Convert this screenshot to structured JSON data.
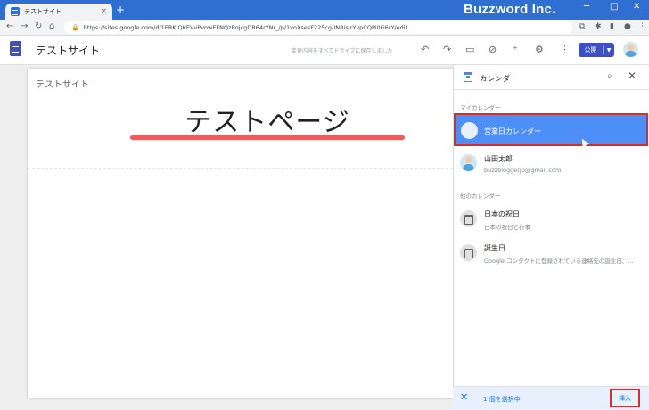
{
  "browser": {
    "tab_title": "テストサイト",
    "tab_close": "×",
    "new_tab": "+",
    "brand": "Buzzword Inc.",
    "url": "https://sites.google.com/d/1ERKlQKEVvPvowEFNQzRojcgDR64rYNr_/p/1voXsesF225cg-INRislrYvpCQPi0G6rY/edit",
    "nav": {
      "back": "←",
      "forward": "→",
      "reload": "↻",
      "home": "⌂"
    },
    "window_controls": {
      "minimize": "─",
      "maximize": "□",
      "close": "✕"
    }
  },
  "sites_header": {
    "site_name": "テストサイト",
    "save_status": "変更内容をすべてドライブに保存しました",
    "publish_label": "公開",
    "publish_arrow": "▼",
    "tools": [
      "↶",
      "↷",
      "▭",
      "⊘",
      "⁺",
      "⚙",
      "⋮"
    ]
  },
  "page": {
    "site_label": "テストサイト",
    "title": "テストページ"
  },
  "calendar_panel": {
    "title": "カレンダー",
    "my_calendars_label": "マイカレンダー",
    "other_calendars_label": "他のカレンダー",
    "my_calendars": [
      {
        "name": "営業日カレンダー",
        "selected": true
      },
      {
        "name": "山田太郎",
        "sub": "buzzbloggerjp@gmail.com"
      }
    ],
    "other_calendars": [
      {
        "name": "日本の祝日",
        "sub": "日本の祝日と行事"
      },
      {
        "name": "誕生日",
        "sub": "Google コンタクトに登録されている連絡先の誕生日、..."
      }
    ],
    "footer": {
      "close": "✕",
      "selected_count": "1 個を選択中",
      "insert_label": "挿入"
    }
  },
  "colors": {
    "browser_blue": "#2f6fd2",
    "publish_blue": "#3c4fc4",
    "selected_blue": "#4d8ef7",
    "highlight_red": "#d32f2f",
    "title_underline": "#f05a5a"
  }
}
